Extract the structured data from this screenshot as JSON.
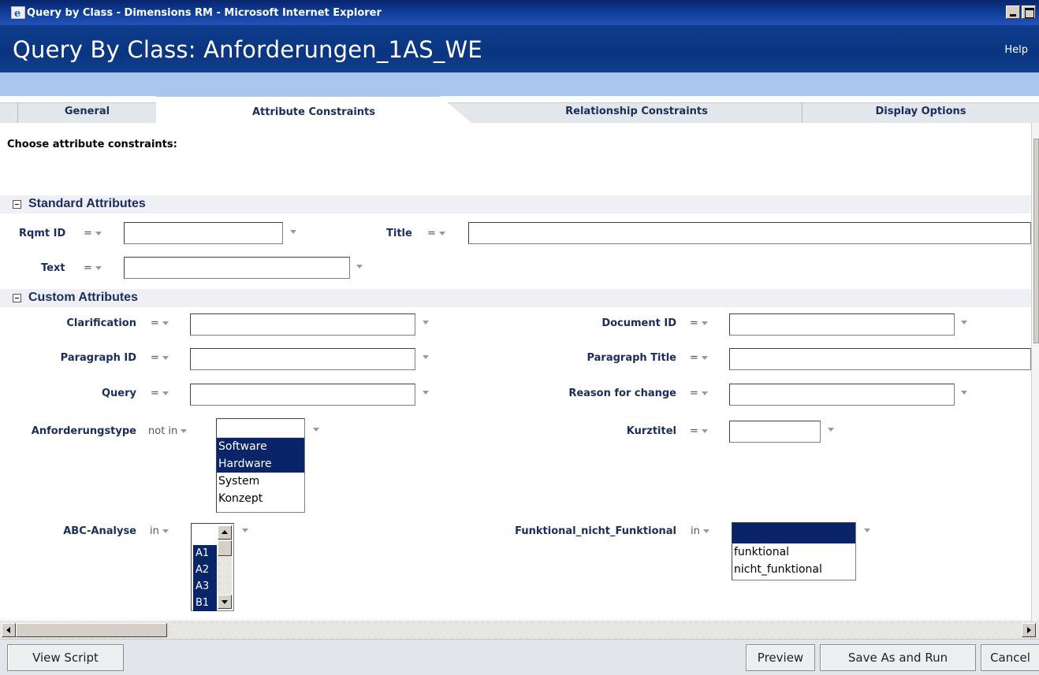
{
  "window": {
    "title": "Query by Class - Dimensions RM - Microsoft Internet Explorer"
  },
  "header": {
    "title": "Query By Class: Anforderungen_1AS_WE",
    "help": "Help"
  },
  "tabs": [
    {
      "label": "General"
    },
    {
      "label": "Attribute Constraints",
      "active": true
    },
    {
      "label": "Relationship Constraints"
    },
    {
      "label": "Display Options"
    }
  ],
  "instruction": "Choose attribute constraints:",
  "standard": {
    "heading": "Standard Attributes",
    "rqmt_id": {
      "label": "Rqmt ID",
      "op": "=",
      "value": ""
    },
    "title": {
      "label": "Title",
      "op": "=",
      "value": ""
    },
    "text": {
      "label": "Text",
      "op": "=",
      "value": ""
    }
  },
  "custom": {
    "heading": "Custom Attributes",
    "clarification": {
      "label": "Clarification",
      "op": "=",
      "value": ""
    },
    "document_id": {
      "label": "Document ID",
      "op": "=",
      "value": ""
    },
    "paragraph_id": {
      "label": "Paragraph ID",
      "op": "=",
      "value": ""
    },
    "paragraph_title": {
      "label": "Paragraph Title",
      "op": "=",
      "value": ""
    },
    "query": {
      "label": "Query",
      "op": "=",
      "value": ""
    },
    "reason_for_change": {
      "label": "Reason for change",
      "op": "=",
      "value": ""
    },
    "anforderungstype": {
      "label": "Anforderungstype",
      "op": "not in",
      "options": [
        {
          "text": "Software",
          "selected": true
        },
        {
          "text": "Hardware",
          "selected": true
        },
        {
          "text": "System",
          "selected": false
        },
        {
          "text": "Konzept",
          "selected": false
        }
      ]
    },
    "kurztitel": {
      "label": "Kurztitel",
      "op": "=",
      "value": ""
    },
    "abc_analyse": {
      "label": "ABC-Analyse",
      "op": "in",
      "options": [
        {
          "text": "A1",
          "selected": true
        },
        {
          "text": "A2",
          "selected": true
        },
        {
          "text": "A3",
          "selected": true
        },
        {
          "text": "B1",
          "selected": true
        }
      ]
    },
    "funktional": {
      "label": "Funktional_nicht_Funktional",
      "op": "in",
      "options": [
        {
          "text": "funktional",
          "selected": false
        },
        {
          "text": "nicht_funktional",
          "selected": false
        }
      ]
    }
  },
  "footer": {
    "view_script": "View Script",
    "preview": "Preview",
    "save_run": "Save As and Run",
    "cancel": "Cancel"
  },
  "colors": {
    "header_bg": "#0e3d8c",
    "selection": "#0a246a",
    "label": "#1a2d5c"
  }
}
